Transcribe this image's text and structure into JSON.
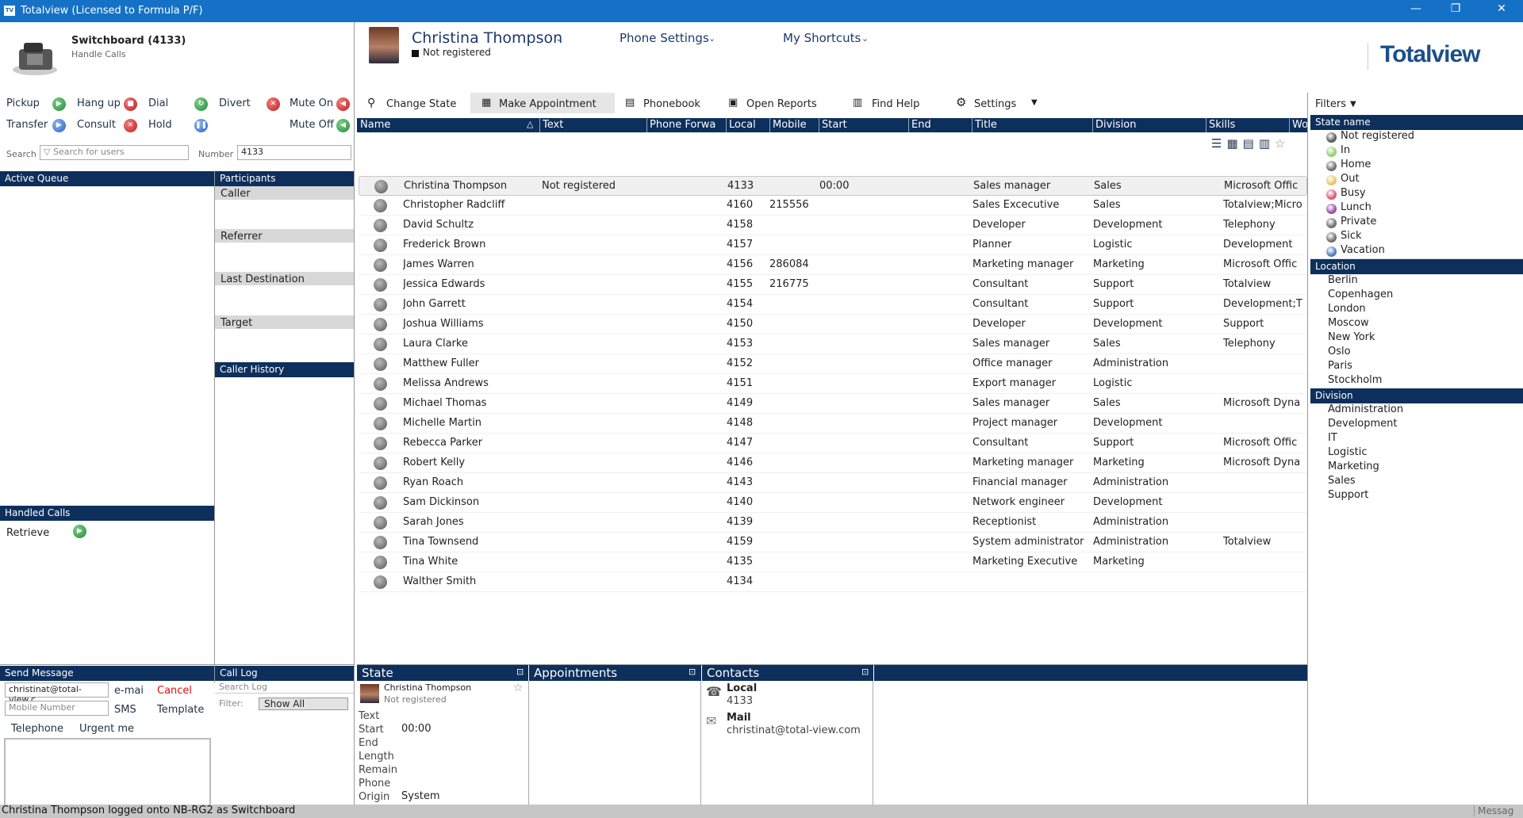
{
  "window": {
    "title": "Totalview  (Licensed to Formula P/F)",
    "logo": "TV",
    "min": "—",
    "restore": "❐",
    "close": "✕"
  },
  "switchboard": {
    "title": "Switchboard (4133)",
    "subtitle": "Handle Calls"
  },
  "call_buttons": {
    "pickup": "Pickup",
    "hangup": "Hang up",
    "dial": "Dial",
    "divert": "Divert",
    "mute_on": "Mute On",
    "transfer": "Transfer",
    "consult": "Consult",
    "hold": "Hold",
    "mute_off": "Mute Off"
  },
  "search": {
    "label": "Search",
    "placeholder": "Search for users",
    "number_label": "Number",
    "number_value": "4133"
  },
  "queue": {
    "active_queue": "Active Queue",
    "participants": "Participants",
    "caller": "Caller",
    "referrer": "Referrer",
    "last_destination": "Last Destination",
    "target": "Target",
    "caller_history": "Caller History",
    "handled_calls": "Handled Calls",
    "retrieve": "Retrieve"
  },
  "send_message": {
    "header": "Send Message",
    "email_value": "christinat@total-view.c",
    "email": "e-mai",
    "cancel": "Cancel",
    "mobile_placeholder": "Mobile Number",
    "sms": "SMS",
    "template": "Template",
    "telephone": "Telephone",
    "urgent": "Urgent me"
  },
  "call_log": {
    "header": "Call Log",
    "search_placeholder": "Search Log",
    "filter_label": "Filter:",
    "filter_value": "Show All"
  },
  "profile": {
    "name": "Christina Thompson",
    "status": "Not registered",
    "phone_settings": "Phone Settings",
    "shortcuts": "My Shortcuts",
    "brand": "Totalview"
  },
  "toolbar": {
    "change_state": "Change State",
    "make_appointment": "Make Appointment",
    "phonebook": "Phonebook",
    "open_reports": "Open Reports",
    "find_help": "Find Help",
    "settings": "Settings"
  },
  "columns": {
    "name": "Name",
    "text": "Text",
    "phone_forward": "Phone Forwa",
    "local": "Local",
    "mobile": "Mobile",
    "start": "Start",
    "end": "End",
    "title": "Title",
    "division": "Division",
    "skills": "Skills",
    "wo": "Wo"
  },
  "people": [
    {
      "name": "Christina Thompson",
      "text": "Not registered",
      "local": "4133",
      "mobile": "",
      "start": "00:00",
      "title": "Sales manager",
      "division": "Sales",
      "skills": "Microsoft Offic"
    },
    {
      "name": "Christopher Radcliff",
      "text": "",
      "local": "4160",
      "mobile": "215556",
      "start": "",
      "title": "Sales Excecutive",
      "division": "Sales",
      "skills": "Totalview;Micro"
    },
    {
      "name": "David Schultz",
      "text": "",
      "local": "4158",
      "mobile": "",
      "start": "",
      "title": "Developer",
      "division": "Development",
      "skills": "Telephony"
    },
    {
      "name": "Frederick Brown",
      "text": "",
      "local": "4157",
      "mobile": "",
      "start": "",
      "title": "Planner",
      "division": "Logistic",
      "skills": "Development"
    },
    {
      "name": "James Warren",
      "text": "",
      "local": "4156",
      "mobile": "286084",
      "start": "",
      "title": "Marketing manager",
      "division": "Marketing",
      "skills": "Microsoft Offic"
    },
    {
      "name": "Jessica Edwards",
      "text": "",
      "local": "4155",
      "mobile": "216775",
      "start": "",
      "title": "Consultant",
      "division": "Support",
      "skills": "Totalview"
    },
    {
      "name": "John Garrett",
      "text": "",
      "local": "4154",
      "mobile": "",
      "start": "",
      "title": "Consultant",
      "division": "Support",
      "skills": "Development;T"
    },
    {
      "name": "Joshua Williams",
      "text": "",
      "local": "4150",
      "mobile": "",
      "start": "",
      "title": "Developer",
      "division": "Development",
      "skills": "Support"
    },
    {
      "name": "Laura Clarke",
      "text": "",
      "local": "4153",
      "mobile": "",
      "start": "",
      "title": "Sales manager",
      "division": "Sales",
      "skills": "Telephony"
    },
    {
      "name": "Matthew Fuller",
      "text": "",
      "local": "4152",
      "mobile": "",
      "start": "",
      "title": "Office manager",
      "division": "Administration",
      "skills": ""
    },
    {
      "name": "Melissa Andrews",
      "text": "",
      "local": "4151",
      "mobile": "",
      "start": "",
      "title": "Export manager",
      "division": "Logistic",
      "skills": ""
    },
    {
      "name": "Michael Thomas",
      "text": "",
      "local": "4149",
      "mobile": "",
      "start": "",
      "title": "Sales manager",
      "division": "Sales",
      "skills": "Microsoft Dyna"
    },
    {
      "name": "Michelle Martin",
      "text": "",
      "local": "4148",
      "mobile": "",
      "start": "",
      "title": "Project manager",
      "division": "Development",
      "skills": ""
    },
    {
      "name": "Rebecca Parker",
      "text": "",
      "local": "4147",
      "mobile": "",
      "start": "",
      "title": "Consultant",
      "division": "Support",
      "skills": "Microsoft Offic"
    },
    {
      "name": "Robert Kelly",
      "text": "",
      "local": "4146",
      "mobile": "",
      "start": "",
      "title": "Marketing manager",
      "division": "Marketing",
      "skills": "Microsoft Dyna"
    },
    {
      "name": "Ryan Roach",
      "text": "",
      "local": "4143",
      "mobile": "",
      "start": "",
      "title": "Financial manager",
      "division": "Administration",
      "skills": ""
    },
    {
      "name": "Sam Dickinson",
      "text": "",
      "local": "4140",
      "mobile": "",
      "start": "",
      "title": "Network engineer",
      "division": "Development",
      "skills": ""
    },
    {
      "name": "Sarah Jones",
      "text": "",
      "local": "4139",
      "mobile": "",
      "start": "",
      "title": "Receptionist",
      "division": "Administration",
      "skills": ""
    },
    {
      "name": "Tina Townsend",
      "text": "",
      "local": "4159",
      "mobile": "",
      "start": "",
      "title": "System administrator",
      "division": "Administration",
      "skills": "Totalview"
    },
    {
      "name": "Tina White",
      "text": "",
      "local": "4135",
      "mobile": "",
      "start": "",
      "title": "Marketing Executive",
      "division": "Marketing",
      "skills": ""
    },
    {
      "name": "Walther Smith",
      "text": "",
      "local": "4134",
      "mobile": "",
      "start": "",
      "title": "",
      "division": "",
      "skills": ""
    }
  ],
  "filters": {
    "label": "Filters",
    "state_header": "State name",
    "states": [
      {
        "label": "Not registered",
        "color": "#5a5a5a"
      },
      {
        "label": "In",
        "color": "#8fd36b"
      },
      {
        "label": "Home",
        "color": "#6f6f6f"
      },
      {
        "label": "Out",
        "color": "#e9c46a"
      },
      {
        "label": "Busy",
        "color": "#d85a7a"
      },
      {
        "label": "Lunch",
        "color": "#a04aa8"
      },
      {
        "label": "Private",
        "color": "#6f6f6f"
      },
      {
        "label": "Sick",
        "color": "#6f6f6f"
      },
      {
        "label": "Vacation",
        "color": "#4a7fc4"
      }
    ],
    "location_header": "Location",
    "locations": [
      "Berlin",
      "Copenhagen",
      "London",
      "Moscow",
      "New York",
      "Oslo",
      "Paris",
      "Stockholm"
    ],
    "division_header": "Division",
    "divisions": [
      "Administration",
      "Development",
      "IT",
      "Logistic",
      "Marketing",
      "Sales",
      "Support"
    ]
  },
  "state_panel": {
    "header": "State",
    "name": "Christina Thompson",
    "status": "Not registered",
    "labels": [
      "Text",
      "Start",
      "End",
      "Length",
      "Remain",
      "Phone",
      "Origin"
    ],
    "start_value": "00:00",
    "origin_value": "System"
  },
  "appointments_panel": {
    "header": "Appointments"
  },
  "contacts_panel": {
    "header": "Contacts",
    "local_label": "Local",
    "local_value": "4133",
    "mail_label": "Mail",
    "mail_value": "christinat@total-view.com"
  },
  "statusbar": {
    "text": "Christina Thompson logged onto NB-RG2 as Switchboard",
    "right": "Messag"
  }
}
